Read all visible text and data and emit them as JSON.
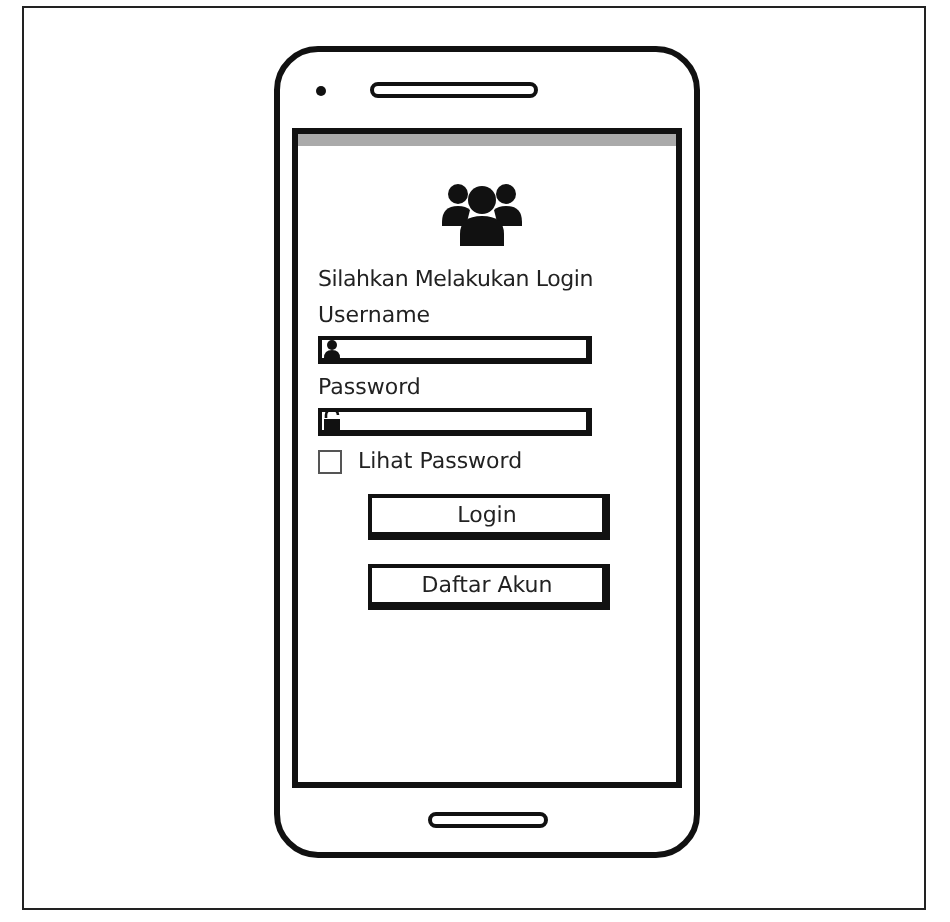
{
  "screen": {
    "heading": "Silahkan Melakukan Login",
    "fields": [
      {
        "label": "Username",
        "kind": "user"
      },
      {
        "label": "Password",
        "kind": "lock"
      }
    ],
    "show_password": {
      "label": "Lihat Password",
      "checked": false
    },
    "buttons": [
      "Login",
      "Daftar Akun"
    ]
  }
}
